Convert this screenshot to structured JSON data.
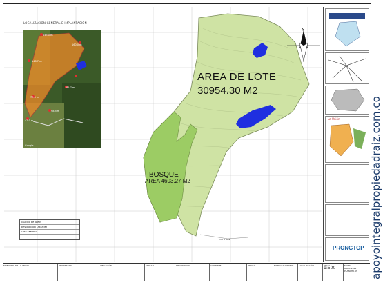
{
  "map": {
    "inset_title": "LOCALIZACIÓN GENERAL E IMPLANTACIÓN",
    "inset_labels": [
      "145.0 m",
      "160.0 m",
      "148.7 m",
      "73.3 m",
      "85.7 m",
      "98.5 m",
      "42.0 m",
      "Google"
    ],
    "lot_area_title": "AREA DE LOTE",
    "lot_area_value": "30954.30 M2",
    "forest_title": "BOSQUE",
    "forest_area": "AREA 4603.27 M2",
    "north_label": "N",
    "road_label": "VIA A SAN"
  },
  "area_table": {
    "title": "CUADRO DE AREAS",
    "col1": "DESCRIPCION",
    "col2": "AREA M2",
    "row_label": "LOTE GENERAL"
  },
  "sidebar": {
    "inset3_title": "La Unión",
    "logo": "PRONGTOP"
  },
  "title_block": {
    "municipality": "MUNICIPIO DE LA UNION",
    "cells": [
      "PROPIETARIO",
      "UBICACIÓN",
      "CÉDULA",
      "DESCRIPCIÓN",
      "CONTIENE",
      "REVISÓ",
      "MATRICULA INMOB.",
      "LOCALIZACIÓN",
      "ESCALA",
      "FECHA"
    ],
    "scale": "1:500",
    "date": "ABRIL 2024",
    "sheet": "PLANCHA Nº"
  },
  "watermark": "apoyointegralpropiedadraiz.com.co",
  "colors": {
    "lot": "#cfe3a4",
    "forest": "#9ccc64",
    "water": "#1f2fe0",
    "inset_overlay": "#f08a28",
    "boundary": "#b33"
  }
}
